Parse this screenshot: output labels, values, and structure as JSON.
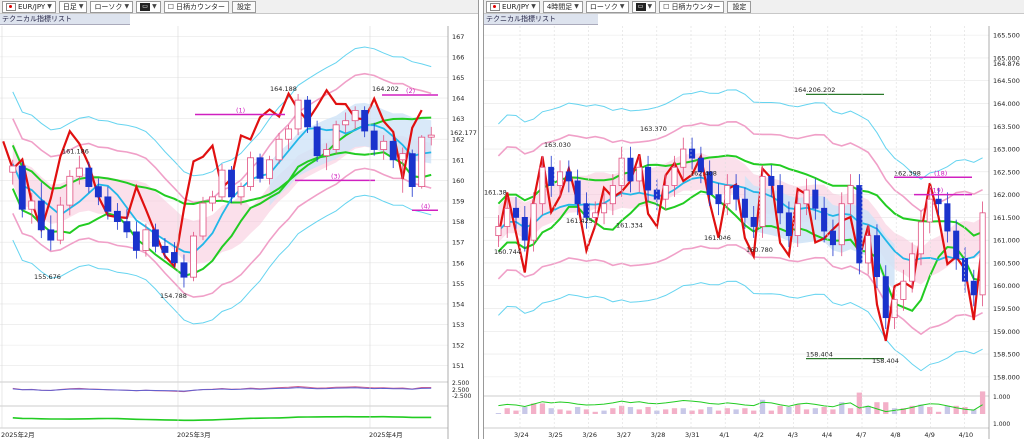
{
  "left": {
    "toolbar": {
      "pair": "EUR/JPY",
      "timeframe": "日足",
      "style": "ローソク",
      "counter": "日柄カウンター",
      "settings": "設定"
    },
    "tech_list_label": "テクニカル指標リスト",
    "y_ticks": [
      "167",
      "166",
      "165",
      "164",
      "163",
      "162",
      "161",
      "160",
      "159",
      "158",
      "157",
      "156",
      "155",
      "154",
      "153",
      "152",
      "151"
    ],
    "x_labels": [
      "2025年2月",
      "2025年3月",
      "2025年4月"
    ],
    "annotations": {
      "high_1": "164.188",
      "high_2": "164.202",
      "low_1": "155.676",
      "low_2": "154.788",
      "peak_1": "161.186",
      "current": "162.177",
      "c1": "(1)",
      "c2": "(2)",
      "c3": "(3)",
      "c4": "(4)"
    },
    "osc_labels": [
      "2.500",
      "2.500",
      "-2.500"
    ],
    "colors": {
      "ichimoku_cloud": "#f7c6db",
      "cloud_blue": "#cfe3f7",
      "candle_bull": "#ffffff",
      "candle_bear": "#1a33cc",
      "line_red": "#e01010",
      "ma_green": "#22cc22",
      "bb_pink": "#f0a0c8",
      "bb_cyan": "#66d4f0",
      "line_cyan": "#22b7e8",
      "line_magenta": "#d020c0"
    },
    "chart_data": {
      "type": "candlestick",
      "ylim": [
        150.5,
        167.5
      ],
      "candles": [
        [
          160.4,
          161.0,
          159.8,
          160.7
        ],
        [
          160.7,
          160.9,
          158.2,
          158.6
        ],
        [
          158.6,
          159.4,
          157.9,
          159.0
        ],
        [
          159.0,
          159.9,
          157.2,
          157.6
        ],
        [
          157.6,
          158.3,
          156.6,
          157.1
        ],
        [
          157.1,
          159.2,
          156.9,
          158.8
        ],
        [
          158.8,
          160.5,
          158.3,
          160.2
        ],
        [
          160.2,
          161.2,
          159.8,
          160.6
        ],
        [
          160.6,
          160.9,
          159.4,
          159.7
        ],
        [
          159.7,
          160.1,
          158.8,
          159.2
        ],
        [
          159.2,
          159.7,
          158.1,
          158.5
        ],
        [
          158.5,
          158.9,
          157.6,
          158.0
        ],
        [
          158.0,
          158.6,
          157.2,
          157.5
        ],
        [
          157.5,
          158.0,
          156.2,
          156.6
        ],
        [
          156.6,
          157.9,
          156.3,
          157.6
        ],
        [
          157.6,
          157.9,
          156.5,
          156.8
        ],
        [
          156.8,
          157.2,
          156.2,
          156.5
        ],
        [
          156.5,
          157.0,
          155.8,
          156.0
        ],
        [
          156.0,
          156.4,
          154.8,
          155.3
        ],
        [
          155.3,
          157.5,
          155.1,
          157.3
        ],
        [
          157.3,
          159.2,
          157.1,
          158.9
        ],
        [
          158.9,
          159.5,
          158.5,
          159.2
        ],
        [
          159.2,
          160.8,
          159.0,
          160.5
        ],
        [
          160.5,
          160.7,
          158.9,
          159.2
        ],
        [
          159.2,
          159.9,
          158.8,
          159.7
        ],
        [
          159.7,
          161.4,
          159.5,
          161.1
        ],
        [
          161.1,
          161.3,
          159.9,
          160.1
        ],
        [
          160.1,
          161.2,
          159.8,
          161.0
        ],
        [
          161.0,
          162.3,
          160.8,
          162.0
        ],
        [
          162.0,
          162.7,
          161.5,
          162.5
        ],
        [
          162.5,
          164.2,
          162.2,
          163.9
        ],
        [
          163.9,
          164.1,
          162.3,
          162.6
        ],
        [
          162.6,
          162.9,
          160.9,
          161.2
        ],
        [
          161.2,
          161.8,
          160.5,
          161.5
        ],
        [
          161.5,
          162.9,
          161.3,
          162.7
        ],
        [
          162.7,
          163.3,
          162.3,
          162.9
        ],
        [
          162.9,
          163.6,
          162.5,
          163.4
        ],
        [
          163.4,
          163.6,
          162.1,
          162.4
        ],
        [
          162.4,
          162.8,
          161.2,
          161.5
        ],
        [
          161.5,
          162.2,
          161.0,
          161.9
        ],
        [
          161.9,
          162.1,
          160.6,
          161.0
        ],
        [
          161.0,
          161.6,
          159.4,
          161.3
        ],
        [
          161.3,
          161.5,
          159.2,
          159.7
        ],
        [
          159.7,
          162.2,
          159.6,
          162.1
        ],
        [
          162.1,
          162.6,
          161.7,
          162.2
        ]
      ]
    }
  },
  "right": {
    "toolbar": {
      "pair": "EUR/JPY",
      "timeframe": "4時間足",
      "style": "ローソク",
      "counter": "日柄カウンター",
      "settings": "設定"
    },
    "tech_list_label": "テクニカル指標リスト",
    "y_ticks": [
      "165.500",
      "165.000",
      "164.500",
      "164.000",
      "163.500",
      "163.000",
      "162.500",
      "162.000",
      "161.500",
      "161.000",
      "160.500",
      "160.000",
      "159.500",
      "159.000",
      "158.500",
      "158.000"
    ],
    "y_extra_tick": "164.876",
    "x_labels": [
      "3/24",
      "3/25",
      "3/26",
      "3/27",
      "3/28",
      "3/31",
      "4/1",
      "4/2",
      "4/3",
      "4/4",
      "4/7",
      "4/8",
      "4/9",
      "4/10"
    ],
    "annotations": {
      "h1": "163.030",
      "h2": "163.370",
      "h3": "162.408",
      "h4": "164.206.202",
      "h5": "162.398",
      "l1": "161.425",
      "l2": "161.334",
      "l3": "161.046",
      "l4": "160.744",
      "l5": "160.780",
      "l6": "158.404",
      "l7": "158.404",
      "left_edge": "161.38",
      "c18": "(18)",
      "c19": "(19)"
    },
    "osc_labels": [
      "1.000",
      "1.000"
    ],
    "chart_data": {
      "type": "candlestick",
      "ylim": [
        157.8,
        165.7
      ],
      "closes": [
        161.3,
        161.7,
        161.5,
        161.0,
        161.8,
        162.6,
        162.2,
        162.5,
        162.3,
        161.8,
        161.5,
        161.6,
        161.8,
        162.2,
        162.8,
        162.3,
        162.6,
        162.1,
        161.9,
        162.2,
        162.6,
        163.0,
        162.8,
        162.5,
        162.0,
        161.8,
        162.2,
        161.9,
        161.5,
        161.3,
        162.4,
        162.2,
        161.6,
        161.1,
        161.8,
        162.1,
        161.7,
        161.2,
        160.9,
        161.8,
        162.2,
        160.5,
        161.1,
        160.2,
        159.3,
        159.7,
        160.1,
        160.7,
        161.4,
        161.9,
        161.8,
        161.2,
        160.6,
        160.1,
        159.8,
        161.6
      ]
    }
  }
}
